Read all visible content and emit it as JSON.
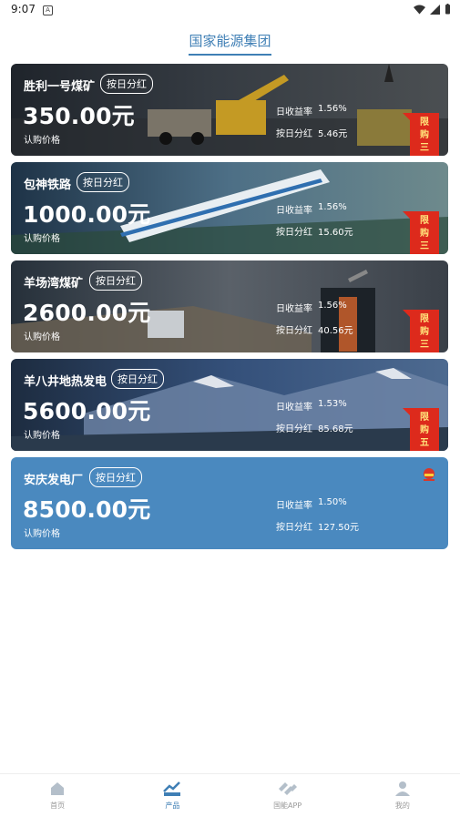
{
  "status_bar": {
    "time": "9:07",
    "notification_glyph": "A"
  },
  "header": {
    "title": "国家能源集团"
  },
  "cards": [
    {
      "name": "胜利一号煤矿",
      "tag": "按日分红",
      "price": "350.00元",
      "price_label": "认购价格",
      "rate_label": "日收益率",
      "rate": "1.56%",
      "dividend_label": "按日分红",
      "dividend": "5.46元",
      "ribbon": [
        "限",
        "购",
        "三"
      ]
    },
    {
      "name": "包神铁路",
      "tag": "按日分红",
      "price": "1000.00元",
      "price_label": "认购价格",
      "rate_label": "日收益率",
      "rate": "1.56%",
      "dividend_label": "按日分红",
      "dividend": "15.60元",
      "ribbon": [
        "限",
        "购",
        "三"
      ]
    },
    {
      "name": "羊场湾煤矿",
      "tag": "按日分红",
      "price": "2600.00元",
      "price_label": "认购价格",
      "rate_label": "日收益率",
      "rate": "1.56%",
      "dividend_label": "按日分红",
      "dividend": "40.56元",
      "ribbon": [
        "限",
        "购",
        "三"
      ]
    },
    {
      "name": "羊八井地热发电",
      "tag": "按日分红",
      "price": "5600.00元",
      "price_label": "认购价格",
      "rate_label": "日收益率",
      "rate": "1.53%",
      "dividend_label": "按日分红",
      "dividend": "85.68元",
      "ribbon": [
        "限",
        "购",
        "五"
      ]
    },
    {
      "name": "安庆发电厂",
      "tag": "按日分红",
      "price": "8500.00元",
      "price_label": "认购价格",
      "rate_label": "日收益率",
      "rate": "1.50%",
      "dividend_label": "按日分红",
      "dividend": "127.50元"
    }
  ],
  "nav": [
    {
      "label": "首页",
      "icon": "home-icon"
    },
    {
      "label": "产品",
      "icon": "chart-icon",
      "active": true
    },
    {
      "label": "国能APP",
      "icon": "brand-icon"
    },
    {
      "label": "我的",
      "icon": "user-icon"
    }
  ],
  "colors": {
    "accent": "#3f7fb5",
    "ribbon": "#dd2a1c",
    "card5": "#4a89bf"
  }
}
